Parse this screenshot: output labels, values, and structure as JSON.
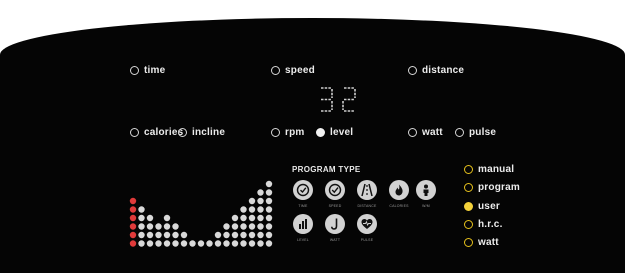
{
  "display": {
    "indicators": [
      {
        "id": "time",
        "label": "time",
        "active": false
      },
      {
        "id": "speed",
        "label": "speed",
        "active": false
      },
      {
        "id": "distance",
        "label": "distance",
        "active": false
      },
      {
        "id": "calories",
        "label": "calories",
        "active": false
      },
      {
        "id": "incline",
        "label": "incline",
        "active": false
      },
      {
        "id": "rpm",
        "label": "rpm",
        "active": false
      },
      {
        "id": "level",
        "label": "level",
        "active": true
      },
      {
        "id": "watt",
        "label": "watt",
        "active": false
      },
      {
        "id": "pulse",
        "label": "pulse",
        "active": false
      }
    ],
    "readout": "32"
  },
  "program": {
    "title": "PROGRAM TYPE",
    "icons": [
      {
        "label": "TIME",
        "icon": "clock-icon"
      },
      {
        "label": "SPEED",
        "icon": "speedometer-icon"
      },
      {
        "label": "DISTANCE",
        "icon": "road-icon"
      },
      {
        "label": "CALORIES",
        "icon": "flame-icon"
      },
      {
        "label": "W/M",
        "icon": "person-icon"
      },
      {
        "label": "LEVEL",
        "icon": "bars-icon"
      },
      {
        "label": "WATT",
        "icon": "hook-icon"
      },
      {
        "label": "PULSE",
        "icon": "heart-pulse-icon"
      }
    ]
  },
  "profile": {
    "columns": [
      6,
      5,
      4,
      3,
      4,
      3,
      2,
      1,
      1,
      1,
      2,
      3,
      4,
      5,
      6,
      7,
      8
    ],
    "red_column_index": 0,
    "colors": {
      "dot": "#d9d9d9",
      "active_dot": "#e03a3a"
    }
  },
  "modes": [
    {
      "label": "manual",
      "active": false
    },
    {
      "label": "program",
      "active": false
    },
    {
      "label": "user",
      "active": true
    },
    {
      "label": "h.r.c.",
      "active": false
    },
    {
      "label": "watt",
      "active": false
    }
  ],
  "colors": {
    "panel": "#050505",
    "mode_led": "#e6c11c"
  }
}
